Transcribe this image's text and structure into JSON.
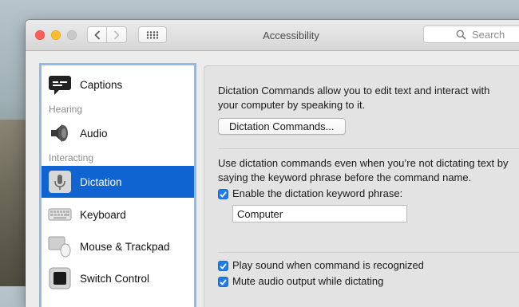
{
  "window": {
    "title": "Accessibility"
  },
  "search": {
    "placeholder": "Search"
  },
  "sidebar": {
    "items": [
      {
        "label": "Captions"
      },
      {
        "label": "Audio"
      },
      {
        "label": "Dictation"
      },
      {
        "label": "Keyboard"
      },
      {
        "label": "Mouse & Trackpad"
      },
      {
        "label": "Switch Control"
      }
    ],
    "headers": [
      "Hearing",
      "Interacting"
    ],
    "selected": "Dictation"
  },
  "content": {
    "description_line1": "Dictation Commands allow you to edit text and interact with",
    "description_line2": "your computer by speaking to it.",
    "commands_button": "Dictation Commands...",
    "keyword_desc_line1": "Use dictation commands even when you’re not dictating text by",
    "keyword_desc_line2": "saying the keyword phrase before the command name.",
    "enable_keyword_label": "Enable the dictation keyword phrase:",
    "enable_keyword_checked": true,
    "keyword_value": "Computer",
    "play_sound_label": "Play sound when command is recognized",
    "play_sound_checked": true,
    "mute_audio_label": "Mute audio output while dictating",
    "mute_audio_checked": true
  },
  "colors": {
    "selection": "#0f64d2",
    "checkbox": "#1e7cf0",
    "close": "#fc5f57",
    "minimize": "#fdbc2e",
    "zoom_disabled": "#c9c9c9"
  }
}
